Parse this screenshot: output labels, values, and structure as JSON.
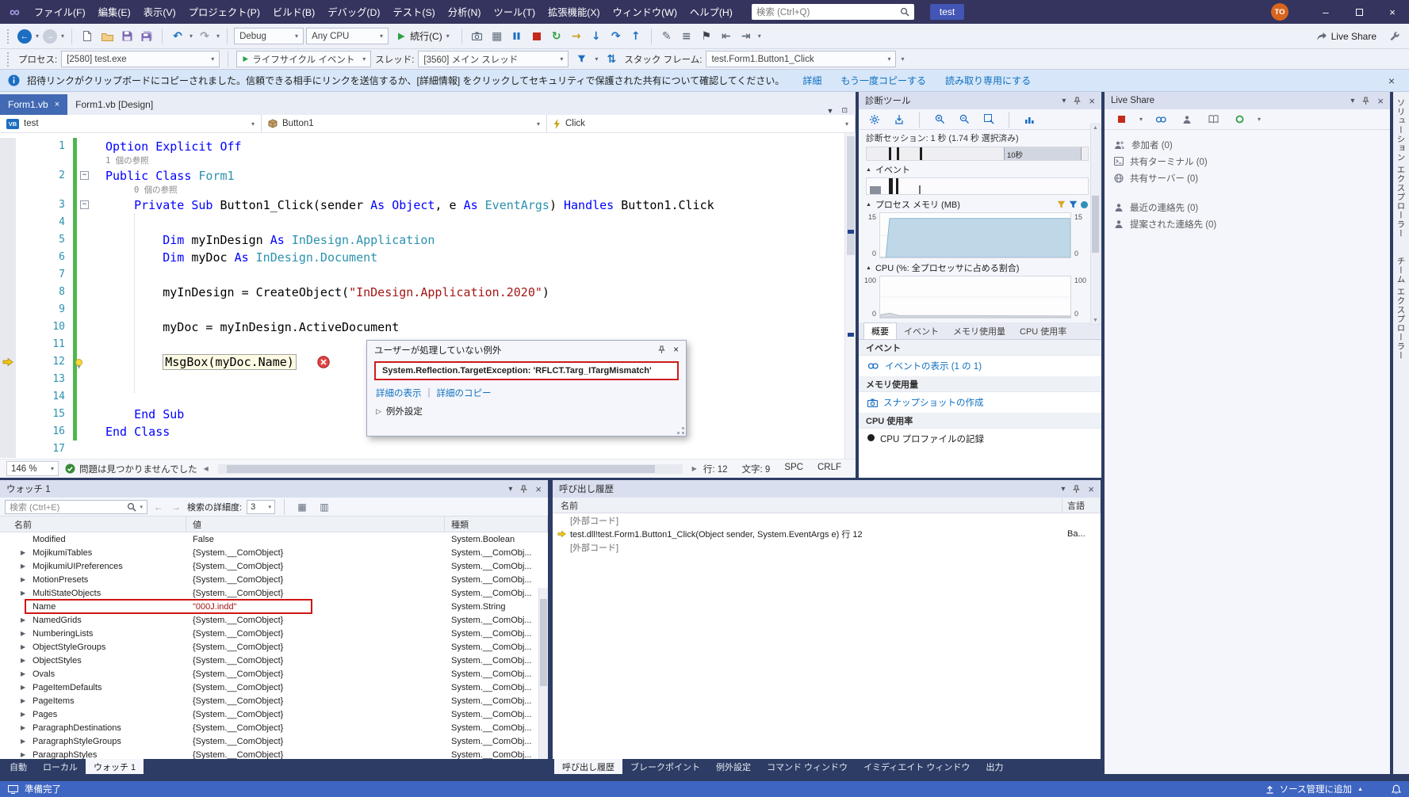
{
  "colors": {
    "accent": "#3E65C2",
    "keyword": "#0000FF",
    "type_name": "#2B91AF",
    "string_literal": "#A31515",
    "error_red": "#CF1B1B",
    "link_blue": "#0E70C0",
    "change_tracking_green": "#4FB64F",
    "avatar_orange": "#D9641E"
  },
  "titlebar": {
    "menus": [
      "ファイル(F)",
      "編集(E)",
      "表示(V)",
      "プロジェクト(P)",
      "ビルド(B)",
      "デバッグ(D)",
      "テスト(S)",
      "分析(N)",
      "ツール(T)",
      "拡張機能(X)",
      "ウィンドウ(W)",
      "ヘルプ(H)"
    ],
    "search_placeholder": "検索 (Ctrl+Q)",
    "window_title": "test",
    "avatar_initials": "TO"
  },
  "toolbar": {
    "configuration": "Debug",
    "platform": "Any CPU",
    "continue_label": "続行(C)",
    "live_share_label": "Live Share"
  },
  "debug_location_bar": {
    "process_label": "プロセス:",
    "process_value": "[2580] test.exe",
    "lifecycle_label": "ライフサイクル イベント",
    "thread_label": "スレッド:",
    "thread_value": "[3560] メイン スレッド",
    "stack_frame_label": "スタック フレーム:",
    "stack_frame_value": "test.Form1.Button1_Click"
  },
  "infobar": {
    "message": "招待リンクがクリップボードにコピーされました。信頼できる相手にリンクを送信するか、[詳細情報] をクリックしてセキュリティで保護された共有について確認してください。",
    "links": [
      "詳細",
      "もう一度コピーする",
      "読み取り専用にする"
    ]
  },
  "editor": {
    "tabs": [
      {
        "label": "Form1.vb",
        "active": true
      },
      {
        "label": "Form1.vb [Design]",
        "active": false
      }
    ],
    "navigation": {
      "project": "test",
      "object": "Button1",
      "member": "Click"
    },
    "code": {
      "lines": [
        {
          "num": "1",
          "ind": 0,
          "segs": [
            [
              "k",
              "Option Explicit Off"
            ]
          ]
        },
        {
          "lens": "1 個の参照",
          "ind": 0
        },
        {
          "num": "2",
          "ind": 0,
          "fold": true,
          "segs": [
            [
              "k",
              "Public Class "
            ],
            [
              "t",
              "Form1"
            ]
          ]
        },
        {
          "lens": "0 個の参照",
          "ind": 4
        },
        {
          "num": "3",
          "ind": 4,
          "fold": true,
          "segs": [
            [
              "k",
              "Private Sub "
            ],
            [
              "p",
              "Button1_Click(sender "
            ],
            [
              "k",
              "As Object"
            ],
            [
              "p",
              ", e "
            ],
            [
              "k",
              "As "
            ],
            [
              "t",
              "EventArgs"
            ],
            [
              "p",
              ") "
            ],
            [
              "k",
              "Handles "
            ],
            [
              "p",
              "Button1.Click"
            ]
          ]
        },
        {
          "num": "4",
          "ind": 0,
          "segs": []
        },
        {
          "num": "5",
          "ind": 8,
          "segs": [
            [
              "k",
              "Dim "
            ],
            [
              "p",
              "myInDesign "
            ],
            [
              "k",
              "As "
            ],
            [
              "t",
              "InDesign.Application"
            ]
          ]
        },
        {
          "num": "6",
          "ind": 8,
          "segs": [
            [
              "k",
              "Dim "
            ],
            [
              "p",
              "myDoc "
            ],
            [
              "k",
              "As "
            ],
            [
              "t",
              "InDesign.Document"
            ]
          ]
        },
        {
          "num": "7",
          "ind": 0,
          "segs": []
        },
        {
          "num": "8",
          "ind": 8,
          "segs": [
            [
              "p",
              "myInDesign = CreateObject("
            ],
            [
              "s",
              "\"InDesign.Application.2020\""
            ],
            [
              "p",
              ")"
            ]
          ]
        },
        {
          "num": "9",
          "ind": 0,
          "segs": []
        },
        {
          "num": "10",
          "ind": 8,
          "segs": [
            [
              "p",
              "myDoc = myInDesign.ActiveDocument"
            ]
          ]
        },
        {
          "num": "11",
          "ind": 0,
          "segs": []
        },
        {
          "num": "12",
          "ind": 8,
          "current": true,
          "error": true,
          "bulb": true,
          "segs": [
            [
              "p",
              "MsgBox(myDoc.Name)"
            ]
          ]
        },
        {
          "num": "13",
          "ind": 0,
          "segs": []
        },
        {
          "num": "14",
          "ind": 0,
          "segs": []
        },
        {
          "num": "15",
          "ind": 4,
          "segs": [
            [
              "k",
              "End Sub"
            ]
          ]
        },
        {
          "num": "16",
          "ind": 0,
          "segs": [
            [
              "k",
              "End Class"
            ]
          ]
        },
        {
          "num": "17",
          "ind": 0,
          "segs": []
        }
      ]
    },
    "exception_popup": {
      "title": "ユーザーが処理していない例外",
      "message": "System.Reflection.TargetException: 'RFLCT.Targ_ITargMismatch'",
      "link1": "詳細の表示",
      "link2": "詳細のコピー",
      "expander": "例外設定"
    },
    "status_bar": {
      "zoom": "146 %",
      "health": "問題は見つかりませんでした",
      "line": "行: 12",
      "column": "文字: 9",
      "spaces": "SPC",
      "line_ending": "CRLF"
    }
  },
  "diagnostics": {
    "title": "診断ツール",
    "session_text": "診断セッション: 1 秒 (1.74 秒 選択済み)",
    "timeline": {
      "selection_label": "10秒",
      "bars": [
        0.1,
        0.135,
        0.24
      ],
      "selection": [
        0.62,
        0.97
      ]
    },
    "events_section": "イベント",
    "events_marks": [
      {
        "x": 0.015,
        "w": 0.05,
        "h": 0.5,
        "c": "#8A8F9C"
      },
      {
        "x": 0.1,
        "w": 0.018,
        "h": 1.0,
        "c": "#1e1e1e"
      },
      {
        "x": 0.132,
        "w": 0.01,
        "h": 1.0,
        "c": "#1e1e1e"
      },
      {
        "x": 0.235,
        "w": 0.008,
        "h": 0.55,
        "c": "#6A6F7A"
      }
    ],
    "memory_section": "プロセス メモリ (MB)",
    "memory_axis": {
      "max": "15",
      "min": "0"
    },
    "memory_series": [
      [
        0,
        0
      ],
      [
        0.03,
        0
      ],
      [
        0.05,
        0.88
      ],
      [
        1,
        0.88
      ]
    ],
    "cpu_section": "CPU (%: 全プロセッサに占める割合)",
    "cpu_axis": {
      "max": "100",
      "min": "0"
    },
    "cpu_series": [
      [
        0,
        0.07
      ],
      [
        0.05,
        0.11
      ],
      [
        0.1,
        0.05
      ],
      [
        0.5,
        0.05
      ],
      [
        1,
        0.04
      ]
    ],
    "tabs": [
      "概要",
      "イベント",
      "メモリ使用量",
      "CPU 使用率"
    ],
    "active_tab": 0,
    "overview": [
      {
        "header": "イベント",
        "item": "イベントの表示 (1 の 1)",
        "icon": "events-link-icon",
        "link": true
      },
      {
        "header": "メモリ使用量",
        "item": "スナップショットの作成",
        "icon": "camera-icon",
        "link": true
      },
      {
        "header": "CPU 使用率",
        "item": "CPU プロファイルの記録",
        "icon": "record-icon",
        "link": false
      }
    ]
  },
  "live_share": {
    "title": "Live Share",
    "session_items": [
      {
        "icon": "participants-icon",
        "label": "参加者 (0)"
      },
      {
        "icon": "shared-terminal-icon",
        "label": "共有ターミナル (0)"
      },
      {
        "icon": "shared-server-icon",
        "label": "共有サーバー (0)"
      }
    ],
    "contact_items": [
      {
        "icon": "recent-contact-icon",
        "label": "最近の連絡先 (0)"
      },
      {
        "icon": "suggested-contact-icon",
        "label": "提案された連絡先 (0)"
      }
    ]
  },
  "side_tabs": [
    "ソリューション エクスプローラー",
    "チーム エクスプローラー"
  ],
  "watch": {
    "title": "ウォッチ 1",
    "search_placeholder": "検索 (Ctrl+E)",
    "depth_label": "検索の詳細度:",
    "depth_value": "3",
    "columns": [
      "名前",
      "値",
      "種類"
    ],
    "rows": [
      {
        "name": "Modified",
        "value": "False",
        "type": "System.Boolean",
        "expandable": false
      },
      {
        "name": "MojikumiTables",
        "value": "{System.__ComObject}",
        "type": "System.__ComObj..."
      },
      {
        "name": "MojikumiUIPreferences",
        "value": "{System.__ComObject}",
        "type": "System.__ComObj..."
      },
      {
        "name": "MotionPresets",
        "value": "{System.__ComObject}",
        "type": "System.__ComObj..."
      },
      {
        "name": "MultiStateObjects",
        "value": "{System.__ComObject}",
        "type": "System.__ComObj..."
      },
      {
        "name": "Name",
        "value": "\"000J.indd\"",
        "type": "System.String",
        "expandable": false,
        "highlighted": true,
        "value_is_string": true
      },
      {
        "name": "NamedGrids",
        "value": "{System.__ComObject}",
        "type": "System.__ComObj..."
      },
      {
        "name": "NumberingLists",
        "value": "{System.__ComObject}",
        "type": "System.__ComObj..."
      },
      {
        "name": "ObjectStyleGroups",
        "value": "{System.__ComObject}",
        "type": "System.__ComObj..."
      },
      {
        "name": "ObjectStyles",
        "value": "{System.__ComObject}",
        "type": "System.__ComObj..."
      },
      {
        "name": "Ovals",
        "value": "{System.__ComObject}",
        "type": "System.__ComObj..."
      },
      {
        "name": "PageItemDefaults",
        "value": "{System.__ComObject}",
        "type": "System.__ComObj..."
      },
      {
        "name": "PageItems",
        "value": "{System.__ComObject}",
        "type": "System.__ComObj..."
      },
      {
        "name": "Pages",
        "value": "{System.__ComObject}",
        "type": "System.__ComObj..."
      },
      {
        "name": "ParagraphDestinations",
        "value": "{System.__ComObject}",
        "type": "System.__ComObj..."
      },
      {
        "name": "ParagraphStyleGroups",
        "value": "{System.__ComObject}",
        "type": "System.__ComObj..."
      },
      {
        "name": "ParagraphStyles",
        "value": "{System.__ComObject}",
        "type": "System.__ComObj..."
      }
    ],
    "tabs": [
      "自動",
      "ローカル",
      "ウォッチ 1"
    ],
    "active_tab": 2
  },
  "call_stack": {
    "title": "呼び出し履歴",
    "columns": [
      "名前",
      "言語"
    ],
    "frames": [
      {
        "name": "[外部コード]",
        "lang": "",
        "external": true
      },
      {
        "name": "test.dll!test.Form1.Button1_Click(Object sender, System.EventArgs e) 行 12",
        "lang": "Ba...",
        "current": true
      },
      {
        "name": "[外部コード]",
        "lang": "",
        "external": true
      }
    ],
    "tabs": [
      "呼び出し履歴",
      "ブレークポイント",
      "例外設定",
      "コマンド ウィンドウ",
      "イミディエイト ウィンドウ",
      "出力"
    ],
    "active_tab": 0
  },
  "status_bar": {
    "ready": "準備完了",
    "source_control": "ソース管理に追加"
  }
}
